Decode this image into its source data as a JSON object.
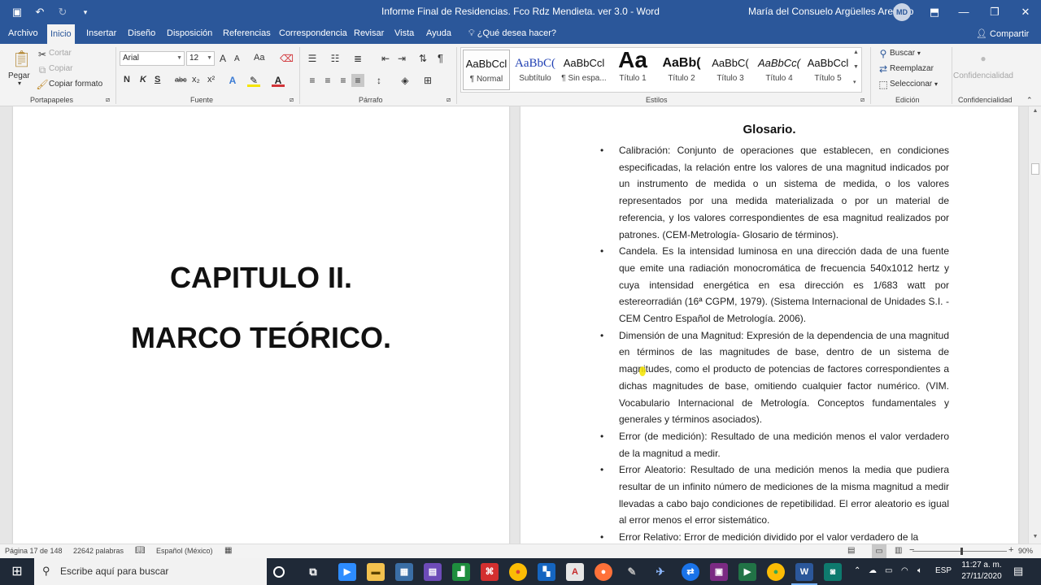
{
  "window": {
    "title": "Informe Final de Residencias.  Fco  Rdz Mendieta. ver 3.0  -  Word",
    "user_name": "María del Consuelo Argüelles Arellano",
    "user_initials": "MD",
    "minimize": "—",
    "restore": "❐",
    "close": "✕"
  },
  "qat": {
    "save_icon": "▣",
    "undo_icon": "↶",
    "redo_icon": "↻",
    "more_icon": "▾"
  },
  "tabs": [
    "Archivo",
    "Inicio",
    "Insertar",
    "Diseño",
    "Disposición",
    "Referencias",
    "Correspondencia",
    "Revisar",
    "Vista",
    "Ayuda",
    "¿Qué desea hacer?"
  ],
  "share_label": "Compartir",
  "ribbon": {
    "clipboard": {
      "paste": "Pegar",
      "cut": "Cortar",
      "copy": "Copiar",
      "format_painter": "Copiar formato",
      "group": "Portapapeles"
    },
    "font": {
      "name": "Arial",
      "size": "12",
      "bold": "N",
      "italic": "K",
      "underline": "S",
      "strike": "abc",
      "sub": "x₂",
      "sup": "x²",
      "grow": "A",
      "shrink": "A",
      "case": "Aa",
      "group": "Fuente"
    },
    "paragraph": {
      "group": "Párrafo",
      "pilcrow": "¶"
    },
    "styles": {
      "group": "Estilos",
      "items": [
        {
          "preview": "AaBbCcl",
          "name": "¶ Normal"
        },
        {
          "preview": "AaBbC(",
          "name": "Subtítulo"
        },
        {
          "preview": "AaBbCcl",
          "name": "¶ Sin espa..."
        },
        {
          "preview": "Aa",
          "name": "Título 1"
        },
        {
          "preview": "AaBb(",
          "name": "Título 2"
        },
        {
          "preview": "AaBbC(",
          "name": "Título 3"
        },
        {
          "preview": "AaBbCc(",
          "name": "Título 4"
        },
        {
          "preview": "AaBbCcl",
          "name": "Título 5"
        }
      ]
    },
    "editing": {
      "find": "Buscar",
      "replace": "Reemplazar",
      "select": "Seleccionar",
      "group": "Edición"
    },
    "confidentiality": {
      "label": "Confidencialidad",
      "group": "Confidencialidad"
    }
  },
  "document": {
    "left_page": {
      "line1": "CAPITULO II.",
      "line2": "MARCO TEÓRICO."
    },
    "right_page": {
      "title": "Glosario.",
      "entries": [
        "Calibración: Conjunto de operaciones que establecen, en condiciones especificadas, la relación entre los valores de una magnitud indicados por un instrumento de medida o un sistema de medida, o los valores representados por una medida materializada o por un material de referencia, y los valores correspondientes de esa magnitud realizados por patrones. (CEM-Metrología- Glosario de términos).",
        "Candela. Es la intensidad luminosa en una dirección dada de una fuente que emite una radiación monocromática de frecuencia 540x1012 hertz y cuya intensidad energética en esa dirección es 1/683 watt por estereorradián (16ª CGPM, 1979). (Sistema Internacional de Unidades S.I. - CEM Centro Español de Metrología. 2006).",
        "Dimensión de una Magnitud: Expresión de la dependencia de una magnitud en términos de las magnitudes de base, dentro de un sistema de magnitudes, como el producto de potencias de factores correspondientes a dichas magnitudes de base, omitiendo cualquier factor numérico. (VIM. Vocabulario Internacional de Metrología. Conceptos fundamentales y generales y términos asociados).",
        "Error (de medición): Resultado de una medición menos el valor verdadero de la magnitud a medir.",
        "Error Aleatorio: Resultado de una medición menos la media que pudiera resultar de un infinito número de mediciones de la misma magnitud a medir llevadas a cabo bajo condiciones de repetibilidad. El error aleatorio es igual al error menos el error sistemático.",
        "Error Relativo: Error de medición dividido por el valor verdadero de la"
      ],
      "bullet": "•"
    }
  },
  "status": {
    "page": "Página 17 de 148",
    "words": "22642 palabras",
    "language": "Español (México)",
    "zoom_minus": "−",
    "zoom_plus": "+",
    "zoom": "90%",
    "zoom_level_fraction": 0.52
  },
  "taskbar": {
    "start_icon": "⊞",
    "search_placeholder": "Escribe aquí para buscar",
    "search_icon": "⚲",
    "tray_lang": "ESP",
    "time": "11:27 a. m.",
    "date": "27/11/2020"
  },
  "colors": {
    "word_blue": "#2b579a",
    "taskbar": "#1f2937",
    "cursor_highlight": "#f5e400"
  }
}
